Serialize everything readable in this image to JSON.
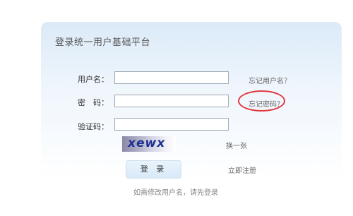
{
  "title": "登录统一用户基础平台",
  "form": {
    "username_label": "用户名：",
    "username_value": "",
    "password_label": "密　码：",
    "password_value": "",
    "captcha_label": "验证码：",
    "captcha_value": ""
  },
  "links": {
    "forgot_username": "忘记用户名？",
    "forgot_password": "忘记密码？",
    "refresh_captcha": "换一张",
    "register": "立即注册"
  },
  "captcha_text": "xewx",
  "login_label": "登 录",
  "note": "如需修改用户名，请先登录",
  "colors": {
    "highlight_ellipse": "#e0393e",
    "captcha_text": "#1d2f8f",
    "panel_top": "#dbeaf8"
  }
}
